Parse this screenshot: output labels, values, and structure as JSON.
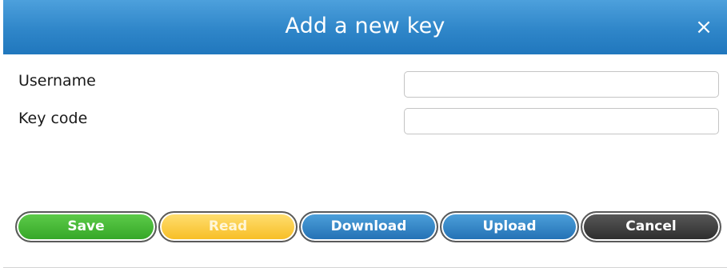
{
  "dialog": {
    "title": "Add a new key",
    "close_glyph": "×"
  },
  "form": {
    "username": {
      "label": "Username",
      "value": "",
      "placeholder": ""
    },
    "key_code": {
      "label": "Key code",
      "value": "",
      "placeholder": ""
    }
  },
  "buttons": {
    "save": "Save",
    "read": "Read",
    "download": "Download",
    "upload": "Upload",
    "cancel": "Cancel"
  },
  "colors": {
    "header_blue": "#2f86c9",
    "save_green": "#33a526",
    "read_yellow": "#f7bd22",
    "download_blue": "#226fb3",
    "upload_blue": "#226fb3",
    "cancel_dark": "#2c2c2c"
  }
}
